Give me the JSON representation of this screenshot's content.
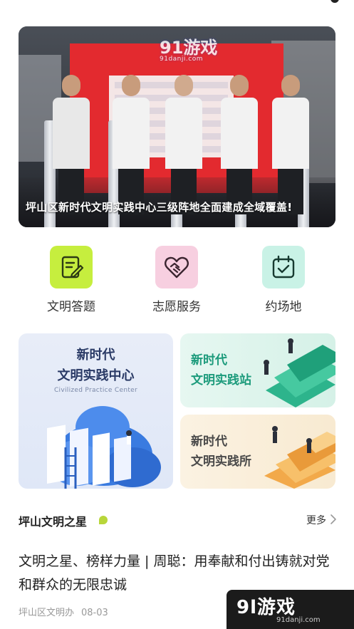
{
  "banner": {
    "caption": "坪山区新时代文明实践中心三级阵地全面建成全域覆盖!",
    "watermark_logo": "91游戏",
    "watermark_site": "91danji.com"
  },
  "quick_entries": [
    {
      "label": "文明答题",
      "icon": "edit-document-icon",
      "color": "#c6ee3e"
    },
    {
      "label": "志愿服务",
      "icon": "heart-handshake-icon",
      "color": "#f7cfe0"
    },
    {
      "label": "约场地",
      "icon": "calendar-check-icon",
      "color": "#c9f2e6"
    }
  ],
  "practice_cards": {
    "center": {
      "line1": "新时代",
      "line2": "文明实践中心",
      "subtitle": "Civilized Practice Center"
    },
    "station": {
      "line1": "新时代",
      "line2": "文明实践站"
    },
    "institute": {
      "line1": "新时代",
      "line2": "文明实践所"
    }
  },
  "section": {
    "title": "坪山文明之星",
    "more_label": "更多"
  },
  "article": {
    "title": "文明之星、榜样力量 | 周聪：用奉献和付出铸就对党和群众的无限忠诚",
    "source": "坪山区文明办",
    "date": "08-03"
  },
  "watermark": {
    "logo": "9l游戏",
    "site": "91danji.com"
  },
  "colors": {
    "accent_green": "#1d9b7c",
    "lime": "#c6ee3e",
    "pink": "#f7cfe0",
    "mint": "#c9f2e6"
  }
}
